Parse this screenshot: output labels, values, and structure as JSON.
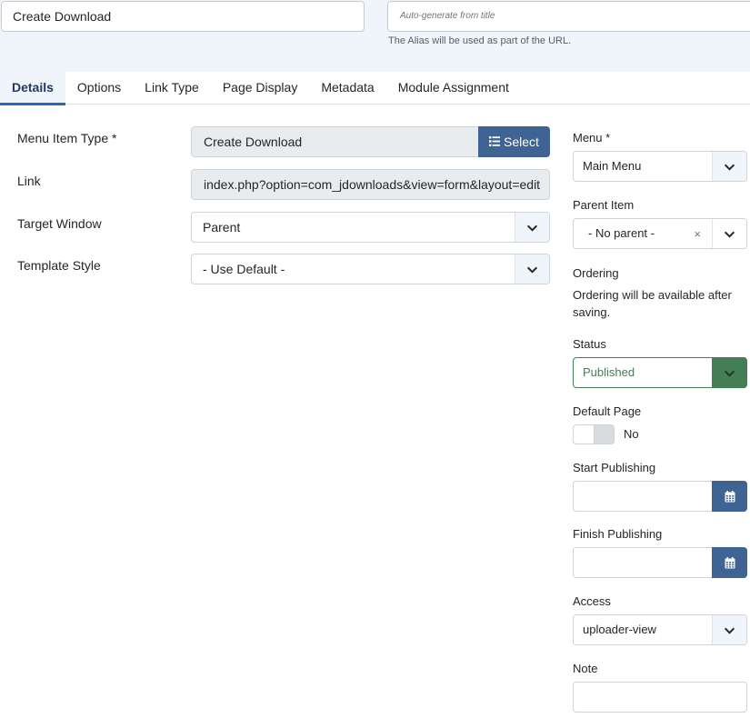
{
  "header": {
    "title_value": "Create Download",
    "alias_placeholder": "Auto-generate from title",
    "alias_help": "The Alias will be used as part of the URL."
  },
  "tabs": [
    {
      "label": "Details",
      "active": true
    },
    {
      "label": "Options"
    },
    {
      "label": "Link Type"
    },
    {
      "label": "Page Display"
    },
    {
      "label": "Metadata"
    },
    {
      "label": "Module Assignment"
    }
  ],
  "details": {
    "menu_item_type_label": "Menu Item Type *",
    "menu_item_type_value": "Create Download",
    "select_button_label": "Select",
    "link_label": "Link",
    "link_value": "index.php?option=com_jdownloads&view=form&layout=edit",
    "target_window_label": "Target Window",
    "target_window_value": "Parent",
    "template_style_label": "Template Style",
    "template_style_value": "- Use Default -"
  },
  "sidebar": {
    "menu_label": "Menu *",
    "menu_value": "Main Menu",
    "parent_label": "Parent Item",
    "parent_value": "- No parent -",
    "parent_clear": "×",
    "ordering_label": "Ordering",
    "ordering_text": "Ordering will be available after saving.",
    "status_label": "Status",
    "status_value": "Published",
    "default_page_label": "Default Page",
    "default_page_value": "No",
    "start_publishing_label": "Start Publishing",
    "finish_publishing_label": "Finish Publishing",
    "access_label": "Access",
    "access_value": "uploader-view",
    "note_label": "Note"
  },
  "colors": {
    "primary": "#3f6393",
    "success": "#457d54",
    "header_bg": "#f0f4fb"
  },
  "icons": {
    "select": "list-icon",
    "dropdown": "chevron-down-icon",
    "calendar": "calendar-icon"
  }
}
